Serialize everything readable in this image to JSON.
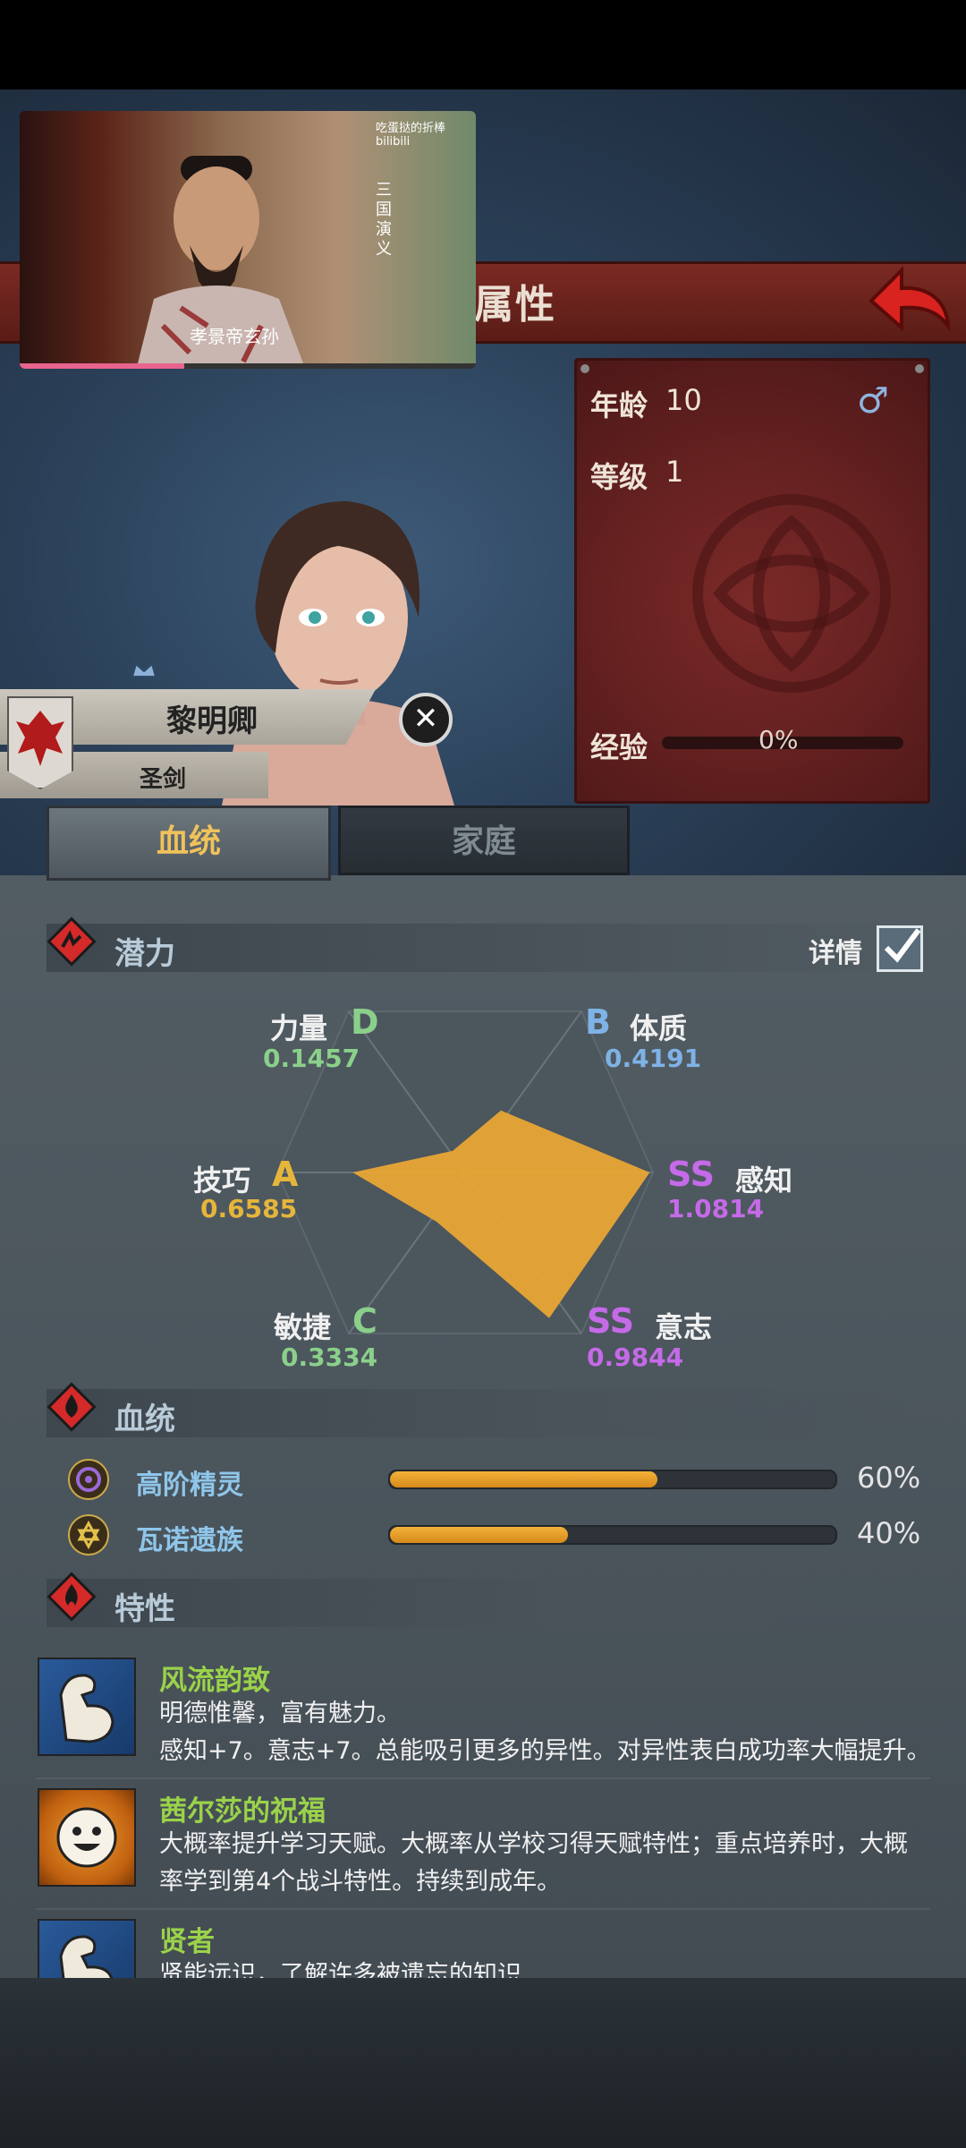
{
  "video": {
    "logo": "吃蛋挞的折棒 bilibili",
    "vertical_text": "三国演义",
    "subtitle": "孝景帝玄孙",
    "progress": 0.36
  },
  "header": {
    "title": "属性"
  },
  "info": {
    "age_label": "年龄",
    "age_value": "10",
    "level_label": "等级",
    "level_value": "1",
    "exp_label": "经验",
    "exp_value": "0%",
    "gender_icon": "male-icon"
  },
  "character": {
    "name": "黎明卿",
    "title": "圣剑"
  },
  "tabs": [
    {
      "label": "血统",
      "active": true
    },
    {
      "label": "家庭",
      "active": false
    }
  ],
  "potential": {
    "section_title": "潜力",
    "detail_label": "详情",
    "stats": [
      {
        "name": "力量",
        "grade": "D",
        "value": "0.1457",
        "color": "#8ad08a"
      },
      {
        "name": "体质",
        "grade": "B",
        "value": "0.4191",
        "color": "#7fb2e6"
      },
      {
        "name": "感知",
        "grade": "SS",
        "value": "1.0814",
        "color": "#c56ae8"
      },
      {
        "name": "意志",
        "grade": "SS",
        "value": "0.9844",
        "color": "#c56ae8"
      },
      {
        "name": "敏捷",
        "grade": "C",
        "value": "0.3334",
        "color": "#8ad08a"
      },
      {
        "name": "技巧",
        "grade": "A",
        "value": "0.6585",
        "color": "#e6b63a"
      }
    ],
    "fill_color": "#e8a634"
  },
  "bloodline": {
    "section_title": "血统",
    "items": [
      {
        "name": "高阶精灵",
        "percent": "60%",
        "fraction": 0.6
      },
      {
        "name": "瓦诺遗族",
        "percent": "40%",
        "fraction": 0.4
      }
    ]
  },
  "traits": {
    "section_title": "特性",
    "items": [
      {
        "name": "风流韵致",
        "desc1": "明德惟馨，富有魅力。",
        "desc2": "感知+7。意志+7。总能吸引更多的异性。对异性表白成功率大幅提升。"
      },
      {
        "name": "茜尔莎的祝福",
        "desc1": "大概率提升学习天赋。大概率从学校习得天赋特性；重点培养时，大概",
        "desc2": "率学到第4个战斗特性。持续到成年。"
      },
      {
        "name": "贤者",
        "desc1": "贤能远识，了解许多被遗忘的知识",
        "desc2": ""
      }
    ]
  }
}
